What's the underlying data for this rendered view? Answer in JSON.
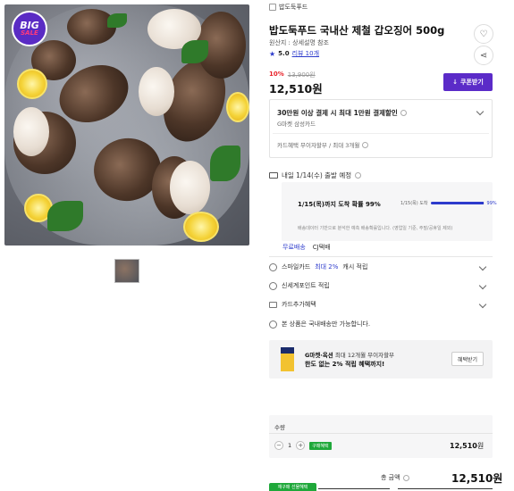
{
  "gallery": {
    "badge_top": "BIG",
    "badge_bottom": "SALE"
  },
  "product": {
    "store": "밥도둑푸드",
    "title": "밥도둑푸드 국내산 제철 갑오징어 500g",
    "origin": "원산지 : 상세설명 참조",
    "rating": "5.0",
    "reviews": "리뷰 10개",
    "discount_pct": "10%",
    "original_price": "13,900원",
    "price": "12,510원",
    "coupon_label": "쿠폰받기"
  },
  "card_offer": {
    "title": "30만원 이상 결제 시 최대 1만원 결제할인",
    "subtitle": "G마켓 삼성카드",
    "installment": "카드혜택 무이자할부 / 최대 3개월"
  },
  "shipping": {
    "header": "내일 1/14(수) 출발 예정",
    "probability": "1/15(목)까지 도착 확률 99%",
    "mini_label": "1/15(목) 도착",
    "mini_pct": "99%",
    "progress": 0.99,
    "note": "배송데이터 기반으로 분석한 예측 배송확률입니다. (영업일 기준, 주말/공휴일 제외)",
    "free": "무료배송",
    "carrier": "CJ택배"
  },
  "benefits": [
    {
      "text": "스마일카드",
      "highlight": "최대 2%",
      "tail": "캐시 적립"
    },
    {
      "text": "신세계포인트 적립",
      "highlight": "",
      "tail": ""
    },
    {
      "text": "카드추가혜택",
      "highlight": "",
      "tail": ""
    }
  ],
  "domestic_note": "본 상품은 국내배송만 가능합니다.",
  "promo": {
    "line1_bold": "G마켓·옥션",
    "line1": "최대 12개월 무이자할부",
    "line2": "한도 없는 2% 적립 혜택까지!",
    "button": "혜택받기"
  },
  "quantity": {
    "label": "수량",
    "minus": "−",
    "value": "1",
    "plus": "+",
    "tag": "구매혜택",
    "price": "12,510",
    "unit": "원"
  },
  "total": {
    "label": "총 금액",
    "price": "12,510원"
  },
  "bottom_tag": "재구매 선물혜택",
  "colors": {
    "accent": "#5b2bc8",
    "link": "#2d3bcc",
    "discount": "#e8232a",
    "green": "#1fa83a"
  }
}
